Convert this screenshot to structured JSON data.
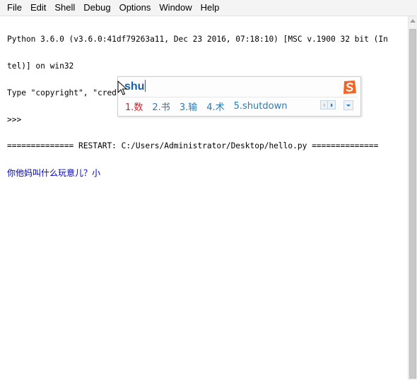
{
  "menu": {
    "items": [
      "File",
      "Edit",
      "Shell",
      "Debug",
      "Options",
      "Window",
      "Help"
    ]
  },
  "shell": {
    "lines": [
      "Python 3.6.0 (v3.6.0:41df79263a11, Dec 23 2016, 07:18:10) [MSC v.1900 32 bit (In",
      "tel)] on win32",
      "Type \"copyright\", \"credits\" or \"license()\" for more information.",
      ">>> ",
      "============== RESTART: C:/Users/Administrator/Desktop/hello.py =============="
    ],
    "output_line": "你他妈叫什么玩意儿？小"
  },
  "ime": {
    "composition": "shu",
    "candidates": [
      "1.数",
      "2.书",
      "3.输",
      "4.术",
      "5.shutdown"
    ],
    "icons": {
      "logo": "sogou-s-logo-icon",
      "prev": "page-prev-icon",
      "next": "page-next-icon",
      "menu": "dropdown-icon"
    }
  },
  "colors": {
    "output_text": "#0000c0",
    "ime_composition": "#1a5fa8",
    "ime_first_candidate": "#d0202a",
    "ime_candidate": "#2a7ab8",
    "ime_logo": "#f26522"
  }
}
